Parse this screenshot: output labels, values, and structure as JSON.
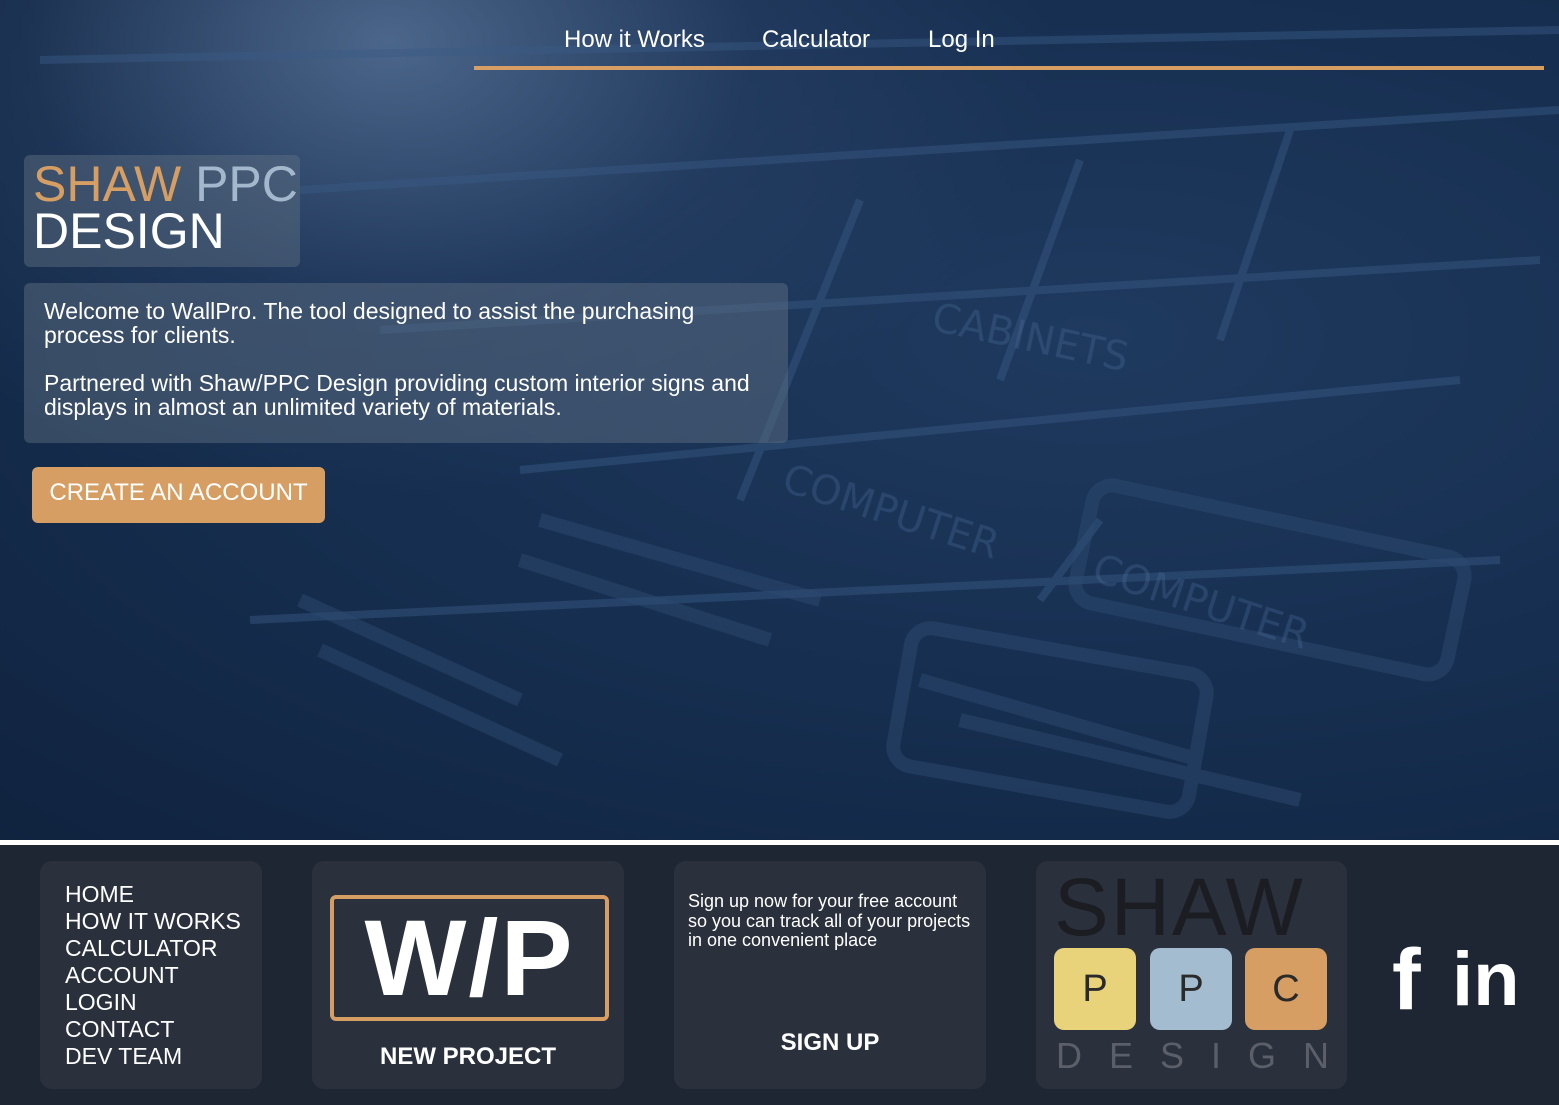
{
  "nav": {
    "items": [
      {
        "label": "How it Works"
      },
      {
        "label": "Calculator"
      },
      {
        "label": "Log In"
      }
    ]
  },
  "hero": {
    "logo_shaw": "SHAW",
    "logo_ppc": "PPC",
    "logo_design": "DESIGN",
    "welcome_p1": "Welcome to WallPro. The tool designed to assist the purchasing process for clients.",
    "welcome_p2": "Partnered with Shaw/PPC Design providing custom interior signs and displays in almost an unlimited variety of materials.",
    "cta_label": "CREATE AN ACCOUNT"
  },
  "footer": {
    "nav_items": [
      "HOME",
      "HOW IT WORKS",
      "CALCULATOR",
      "ACCOUNT",
      "LOGIN",
      "CONTACT",
      "DEV TEAM"
    ],
    "wip_logo": "W/P",
    "new_project_label": "NEW PROJECT",
    "signup_text": "Sign up now for your free account so you can track all of your projects in one convenient place",
    "signup_label": "SIGN UP",
    "brand": {
      "shaw": "SHAW",
      "tiles": [
        {
          "letter": "P",
          "color": "#e8d27a"
        },
        {
          "letter": "P",
          "color": "#a3bccf"
        },
        {
          "letter": "C",
          "color": "#d69e62"
        }
      ],
      "design": "DESIGN"
    },
    "social": {
      "facebook_glyph": "f",
      "linkedin_glyph": "in"
    }
  },
  "colors": {
    "accent": "#d69e62",
    "ppc_blue": "#a3b8cc",
    "footer_bg": "#1e2633",
    "card_bg": "#2a303c"
  }
}
